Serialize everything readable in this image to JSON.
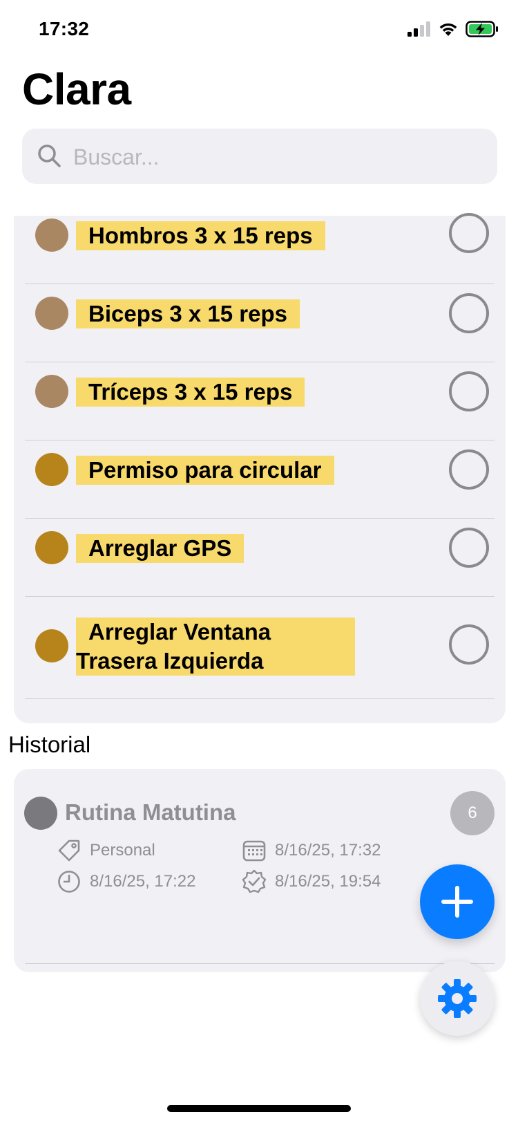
{
  "status_bar": {
    "time": "17:32",
    "icons": [
      "signal-icon",
      "wifi-icon",
      "battery-charging-icon"
    ]
  },
  "header": {
    "title": "Clara"
  },
  "search": {
    "placeholder": "Buscar..."
  },
  "colors": {
    "highlight": "#f8d96b",
    "dot_light": "#a98762",
    "dot_dark": "#b7841c",
    "accent": "#0a7cff"
  },
  "tasks": [
    {
      "label": "Hombros 3 x 15 reps",
      "dot_color": "#a98762"
    },
    {
      "label": "Biceps 3 x 15 reps",
      "dot_color": "#a98762"
    },
    {
      "label": "Tríceps 3 x 15 reps",
      "dot_color": "#a98762"
    },
    {
      "label": "Permiso para circular",
      "dot_color": "#b7841c"
    },
    {
      "label": "Arreglar GPS",
      "dot_color": "#b7841c"
    },
    {
      "label": "Arreglar Ventana Trasera Izquierda",
      "dot_color": "#b7841c"
    }
  ],
  "history": {
    "section_title": "Historial",
    "item": {
      "title": "Rutina Matutina",
      "badge": "6",
      "tag": "Personal",
      "date_due": "8/16/25, 17:32",
      "time_started": "8/16/25, 17:22",
      "time_completed": "8/16/25, 19:54"
    }
  },
  "icons": {
    "search": "search-icon",
    "tag": "tag-icon",
    "calendar": "calendar-icon",
    "clock": "clock-icon",
    "completed": "seal-check-icon",
    "add": "plus-icon",
    "settings": "gear-icon"
  }
}
